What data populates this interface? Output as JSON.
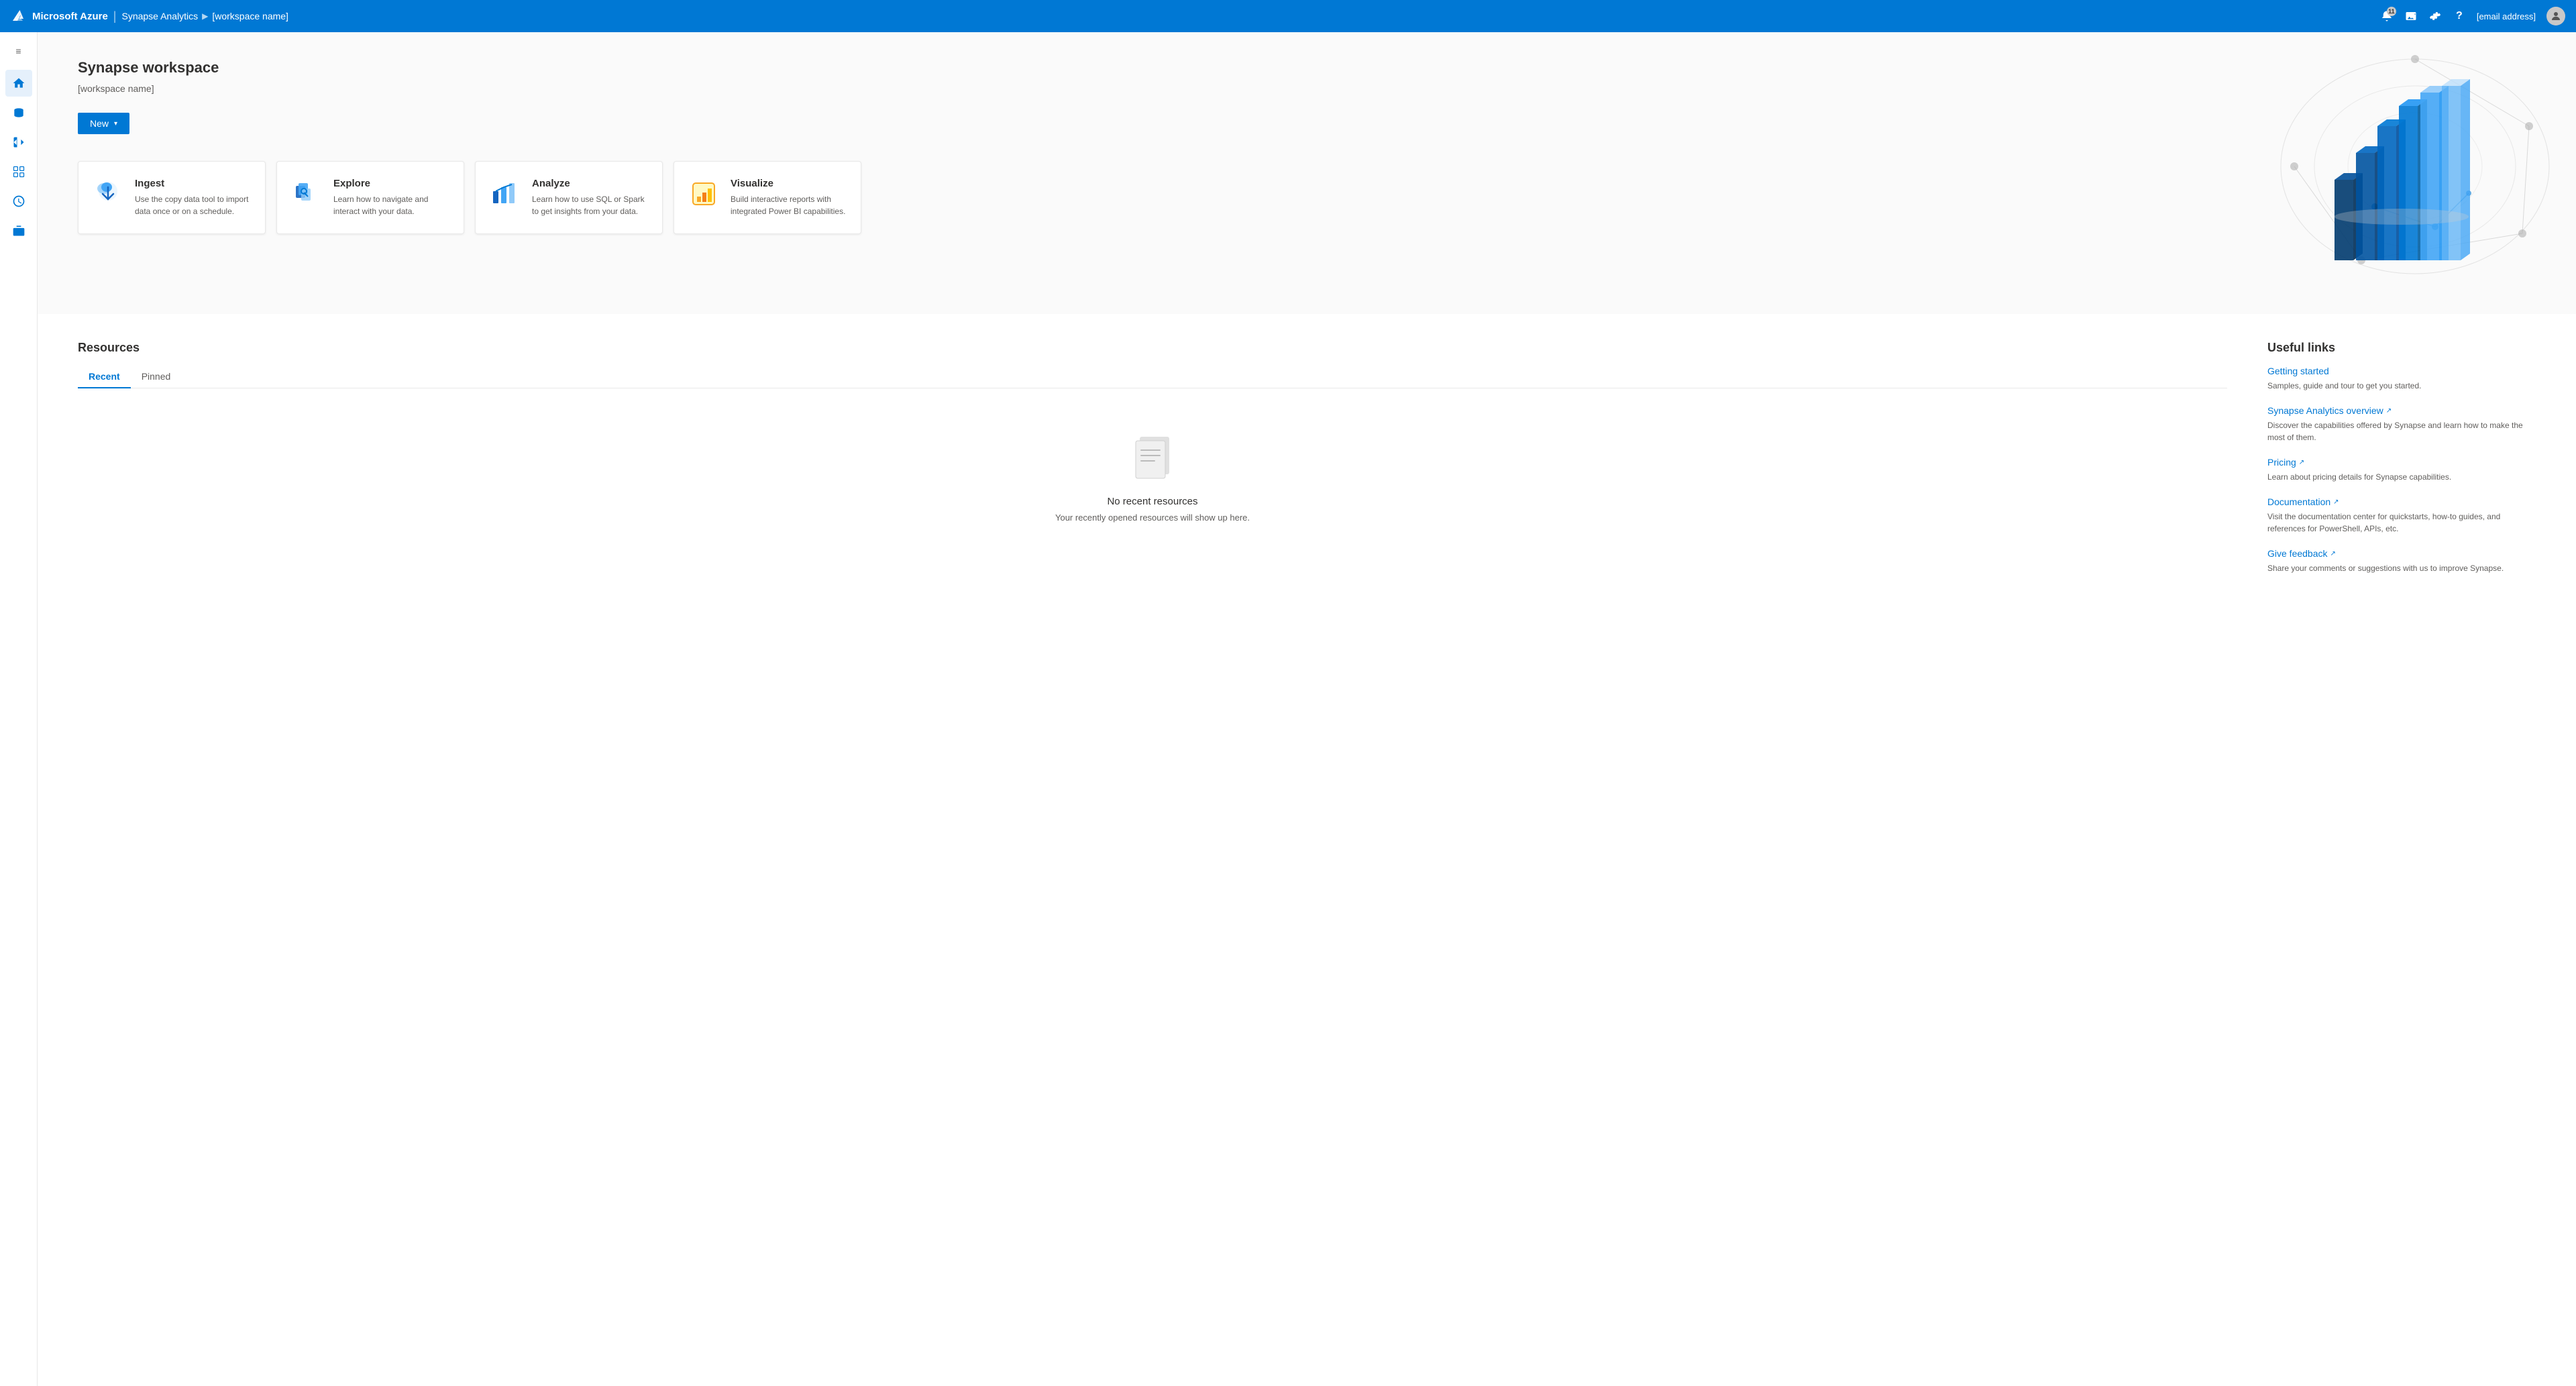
{
  "topnav": {
    "brand": "Microsoft Azure",
    "separator": "|",
    "product": "Synapse Analytics",
    "breadcrumb_arrow": "▶",
    "workspace_name": "[workspace name]",
    "notification_count": "11",
    "email_label": "[email address]"
  },
  "sidebar": {
    "toggle_icon": "≡",
    "items": [
      {
        "id": "home",
        "icon": "home",
        "label": "Home"
      },
      {
        "id": "data",
        "icon": "database",
        "label": "Data"
      },
      {
        "id": "develop",
        "icon": "develop",
        "label": "Develop"
      },
      {
        "id": "integrate",
        "icon": "integrate",
        "label": "Integrate"
      },
      {
        "id": "monitor",
        "icon": "monitor",
        "label": "Monitor"
      },
      {
        "id": "manage",
        "icon": "manage",
        "label": "Manage"
      }
    ]
  },
  "hero": {
    "title": "Synapse workspace",
    "subtitle": "[workspace name]",
    "new_button": "New",
    "dropdown_arrow": "▾"
  },
  "cards": [
    {
      "id": "ingest",
      "title": "Ingest",
      "description": "Use the copy data tool to import data once or on a schedule."
    },
    {
      "id": "explore",
      "title": "Explore",
      "description": "Learn how to navigate and interact with your data."
    },
    {
      "id": "analyze",
      "title": "Analyze",
      "description": "Learn how to use SQL or Spark to get insights from your data."
    },
    {
      "id": "visualize",
      "title": "Visualize",
      "description": "Build interactive reports with integrated Power BI capabilities."
    }
  ],
  "resources": {
    "title": "Resources",
    "tabs": [
      {
        "id": "recent",
        "label": "Recent",
        "active": true
      },
      {
        "id": "pinned",
        "label": "Pinned",
        "active": false
      }
    ],
    "empty_title": "No recent resources",
    "empty_desc": "Your recently opened resources will show up here."
  },
  "useful_links": {
    "title": "Useful links",
    "items": [
      {
        "id": "getting-started",
        "label": "Getting started",
        "has_ext": false,
        "description": "Samples, guide and tour to get you started."
      },
      {
        "id": "synapse-overview",
        "label": "Synapse Analytics overview",
        "has_ext": true,
        "description": "Discover the capabilities offered by Synapse and learn how to make the most of them."
      },
      {
        "id": "pricing",
        "label": "Pricing",
        "has_ext": true,
        "description": "Learn about pricing details for Synapse capabilities."
      },
      {
        "id": "documentation",
        "label": "Documentation",
        "has_ext": true,
        "description": "Visit the documentation center for quickstarts, how-to guides, and references for PowerShell, APIs, etc."
      },
      {
        "id": "give-feedback",
        "label": "Give feedback",
        "has_ext": true,
        "description": "Share your comments or suggestions with us to improve Synapse."
      }
    ]
  }
}
